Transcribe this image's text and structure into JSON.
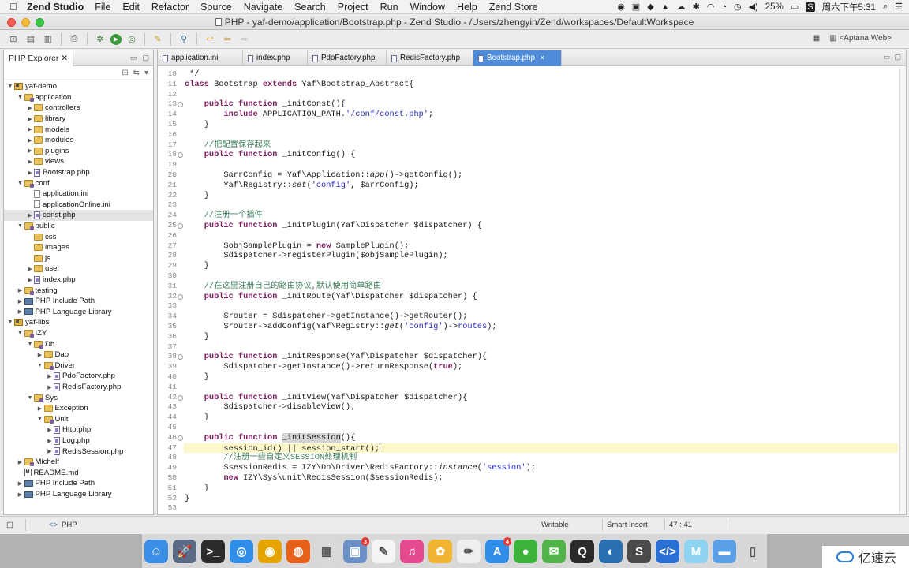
{
  "menubar": {
    "app_name": "Zend Studio",
    "menus": [
      "File",
      "Edit",
      "Refactor",
      "Source",
      "Navigate",
      "Search",
      "Project",
      "Run",
      "Window",
      "Help",
      "Zend Store"
    ],
    "battery": "25%",
    "clock": "周六下午5:31"
  },
  "window": {
    "title": "PHP - yaf-demo/application/Bootstrap.php - Zend Studio - /Users/zhengyin/Zend/workspaces/DefaultWorkspace",
    "perspective": "<Aptana Web>"
  },
  "explorer": {
    "title": "PHP Explorer",
    "tree": [
      {
        "label": "yaf-demo",
        "icon": "project",
        "expanded": true,
        "depth": 0
      },
      {
        "label": "application",
        "icon": "package",
        "expanded": true,
        "depth": 1
      },
      {
        "label": "controllers",
        "icon": "folder",
        "expanded": false,
        "depth": 2
      },
      {
        "label": "library",
        "icon": "folder",
        "expanded": false,
        "depth": 2
      },
      {
        "label": "models",
        "icon": "folder",
        "expanded": false,
        "depth": 2
      },
      {
        "label": "modules",
        "icon": "folder",
        "expanded": false,
        "depth": 2
      },
      {
        "label": "plugins",
        "icon": "folder",
        "expanded": false,
        "depth": 2
      },
      {
        "label": "views",
        "icon": "folder",
        "expanded": false,
        "depth": 2
      },
      {
        "label": "Bootstrap.php",
        "icon": "php",
        "expanded": false,
        "depth": 2
      },
      {
        "label": "conf",
        "icon": "package",
        "expanded": true,
        "depth": 1
      },
      {
        "label": "application.ini",
        "icon": "file",
        "depth": 2
      },
      {
        "label": "applicationOnline.ini",
        "icon": "file",
        "depth": 2
      },
      {
        "label": "const.php",
        "icon": "php",
        "expanded": false,
        "depth": 2,
        "selected": true
      },
      {
        "label": "public",
        "icon": "package",
        "expanded": true,
        "depth": 1
      },
      {
        "label": "css",
        "icon": "folder",
        "depth": 2
      },
      {
        "label": "images",
        "icon": "folder",
        "depth": 2
      },
      {
        "label": "js",
        "icon": "folder",
        "depth": 2
      },
      {
        "label": "user",
        "icon": "folder",
        "expanded": false,
        "depth": 2
      },
      {
        "label": "index.php",
        "icon": "php",
        "expanded": false,
        "depth": 2
      },
      {
        "label": "testing",
        "icon": "package",
        "expanded": false,
        "depth": 1
      },
      {
        "label": "PHP Include Path",
        "icon": "library",
        "expanded": false,
        "depth": 1
      },
      {
        "label": "PHP Language Library",
        "icon": "library",
        "expanded": false,
        "depth": 1
      },
      {
        "label": "yaf-libs",
        "icon": "project",
        "expanded": true,
        "depth": 0
      },
      {
        "label": "IZY",
        "icon": "package",
        "expanded": true,
        "depth": 1
      },
      {
        "label": "Db",
        "icon": "package",
        "expanded": true,
        "depth": 2
      },
      {
        "label": "Dao",
        "icon": "folder",
        "expanded": false,
        "depth": 3
      },
      {
        "label": "Driver",
        "icon": "package",
        "expanded": true,
        "depth": 3
      },
      {
        "label": "PdoFactory.php",
        "icon": "php",
        "expanded": false,
        "depth": 4
      },
      {
        "label": "RedisFactory.php",
        "icon": "php",
        "expanded": false,
        "depth": 4
      },
      {
        "label": "Sys",
        "icon": "package",
        "expanded": true,
        "depth": 2
      },
      {
        "label": "Exception",
        "icon": "folder",
        "expanded": false,
        "depth": 3
      },
      {
        "label": "Unit",
        "icon": "package",
        "expanded": true,
        "depth": 3
      },
      {
        "label": "Http.php",
        "icon": "php",
        "expanded": false,
        "depth": 4
      },
      {
        "label": "Log.php",
        "icon": "php",
        "expanded": false,
        "depth": 4
      },
      {
        "label": "RedisSession.php",
        "icon": "php",
        "expanded": false,
        "depth": 4
      },
      {
        "label": "Michelf",
        "icon": "package",
        "expanded": false,
        "depth": 1
      },
      {
        "label": "README.md",
        "icon": "markdown",
        "depth": 1
      },
      {
        "label": "PHP Include Path",
        "icon": "library",
        "expanded": false,
        "depth": 1
      },
      {
        "label": "PHP Language Library",
        "icon": "library",
        "expanded": false,
        "depth": 1
      }
    ]
  },
  "editor": {
    "tabs": [
      {
        "label": "application.ini",
        "active": false
      },
      {
        "label": "index.php",
        "active": false
      },
      {
        "label": "PdoFactory.php",
        "active": false
      },
      {
        "label": "RedisFactory.php",
        "active": false
      },
      {
        "label": "Bootstrap.php",
        "active": true
      }
    ],
    "current_line": 47,
    "lines": [
      {
        "n": 10,
        "parts": [
          [
            "",
            " */"
          ]
        ]
      },
      {
        "n": 11,
        "parts": [
          [
            "kw",
            "class"
          ],
          [
            "",
            " Bootstrap "
          ],
          [
            "kw",
            "extends"
          ],
          [
            "",
            " Yaf\\Bootstrap_Abstract{"
          ]
        ]
      },
      {
        "n": 12,
        "parts": []
      },
      {
        "n": 13,
        "parts": [
          [
            "",
            "    "
          ],
          [
            "kw",
            "public function"
          ],
          [
            "",
            " _initConst(){"
          ]
        ]
      },
      {
        "n": 14,
        "parts": [
          [
            "",
            "        "
          ],
          [
            "kw",
            "include"
          ],
          [
            "",
            " APPLICATION_PATH."
          ],
          [
            "str",
            "'/conf/const.php'"
          ],
          [
            "",
            ";"
          ]
        ]
      },
      {
        "n": 15,
        "parts": [
          [
            "",
            "    }"
          ]
        ]
      },
      {
        "n": 16,
        "parts": []
      },
      {
        "n": 17,
        "parts": [
          [
            "",
            "    "
          ],
          [
            "cm",
            "//把配置保存起来"
          ]
        ]
      },
      {
        "n": 18,
        "parts": [
          [
            "",
            "    "
          ],
          [
            "kw",
            "public function"
          ],
          [
            "",
            " _initConfig() {"
          ]
        ]
      },
      {
        "n": 19,
        "parts": []
      },
      {
        "n": 20,
        "parts": [
          [
            "",
            "        $arrConfig = Yaf\\Application::"
          ],
          [
            "fn",
            "app"
          ],
          [
            "",
            "()->getConfig();"
          ]
        ]
      },
      {
        "n": 21,
        "parts": [
          [
            "",
            "        Yaf\\Registry::"
          ],
          [
            "fn",
            "set"
          ],
          [
            "",
            "("
          ],
          [
            "str",
            "'config'"
          ],
          [
            "",
            ", $arrConfig);"
          ]
        ]
      },
      {
        "n": 22,
        "parts": [
          [
            "",
            "    }"
          ]
        ]
      },
      {
        "n": 23,
        "parts": []
      },
      {
        "n": 24,
        "parts": [
          [
            "",
            "    "
          ],
          [
            "cm",
            "//注册一个插件"
          ]
        ]
      },
      {
        "n": 25,
        "parts": [
          [
            "",
            "    "
          ],
          [
            "kw",
            "public function"
          ],
          [
            "",
            " _initPlugin(Yaf\\Dispatcher $dispatcher) {"
          ]
        ]
      },
      {
        "n": 26,
        "parts": []
      },
      {
        "n": 27,
        "parts": [
          [
            "",
            "        $objSamplePlugin = "
          ],
          [
            "kw",
            "new"
          ],
          [
            "",
            " SamplePlugin();"
          ]
        ]
      },
      {
        "n": 28,
        "parts": [
          [
            "",
            "        $dispatcher->registerPlugin($objSamplePlugin);"
          ]
        ]
      },
      {
        "n": 29,
        "parts": [
          [
            "",
            "    }"
          ]
        ]
      },
      {
        "n": 30,
        "parts": []
      },
      {
        "n": 31,
        "parts": [
          [
            "",
            "    "
          ],
          [
            "cm",
            "//在这里注册自己的路由协议,默认使用简单路由"
          ]
        ]
      },
      {
        "n": 32,
        "parts": [
          [
            "",
            "    "
          ],
          [
            "kw",
            "public function"
          ],
          [
            "",
            " _initRoute(Yaf\\Dispatcher $dispatcher) {"
          ]
        ]
      },
      {
        "n": 33,
        "parts": []
      },
      {
        "n": 34,
        "parts": [
          [
            "",
            "        $router = $dispatcher->getInstance()->getRouter();"
          ]
        ]
      },
      {
        "n": 35,
        "parts": [
          [
            "",
            "        $router->addConfig(Yaf\\Registry::"
          ],
          [
            "fn",
            "get"
          ],
          [
            "",
            "("
          ],
          [
            "str",
            "'config'"
          ],
          [
            "",
            ")->"
          ],
          [
            "str",
            "routes"
          ],
          [
            "",
            ");"
          ]
        ]
      },
      {
        "n": 36,
        "parts": [
          [
            "",
            "    }"
          ]
        ]
      },
      {
        "n": 37,
        "parts": []
      },
      {
        "n": 38,
        "parts": [
          [
            "",
            "    "
          ],
          [
            "kw",
            "public function"
          ],
          [
            "",
            " _initResponse(Yaf\\Dispatcher $dispatcher){"
          ]
        ]
      },
      {
        "n": 39,
        "parts": [
          [
            "",
            "        $dispatcher->getInstance()->returnResponse("
          ],
          [
            "kw",
            "true"
          ],
          [
            "",
            ");"
          ]
        ]
      },
      {
        "n": 40,
        "parts": [
          [
            "",
            "    }"
          ]
        ]
      },
      {
        "n": 41,
        "parts": []
      },
      {
        "n": 42,
        "parts": [
          [
            "",
            "    "
          ],
          [
            "kw",
            "public function"
          ],
          [
            "",
            " _initView(Yaf\\Dispatcher $dispatcher){"
          ]
        ]
      },
      {
        "n": 43,
        "parts": [
          [
            "",
            "        $dispatcher->disableView();"
          ]
        ]
      },
      {
        "n": 44,
        "parts": [
          [
            "",
            "    }"
          ]
        ]
      },
      {
        "n": 45,
        "parts": []
      },
      {
        "n": 46,
        "parts": [
          [
            "",
            "    "
          ],
          [
            "kw",
            "public function"
          ],
          [
            "",
            " "
          ],
          [
            "hl",
            "_initSession"
          ],
          [
            "",
            "(){"
          ]
        ]
      },
      {
        "n": 47,
        "parts": [
          [
            "",
            "        session_id() || session_start();"
          ]
        ]
      },
      {
        "n": 48,
        "parts": [
          [
            "",
            "        "
          ],
          [
            "cm",
            "//注册一些自定义SESSION处理机制"
          ]
        ]
      },
      {
        "n": 49,
        "parts": [
          [
            "",
            "        $sessionRedis = IZY\\Db\\Driver\\RedisFactory::"
          ],
          [
            "fn",
            "instance"
          ],
          [
            "",
            "("
          ],
          [
            "str",
            "'session'"
          ],
          [
            "",
            ");"
          ]
        ]
      },
      {
        "n": 50,
        "parts": [
          [
            "",
            "        "
          ],
          [
            "kw",
            "new"
          ],
          [
            "",
            " IZY\\Sys\\unit\\RedisSession($sessionRedis);"
          ]
        ]
      },
      {
        "n": 51,
        "parts": [
          [
            "",
            "    }"
          ]
        ]
      },
      {
        "n": 52,
        "parts": [
          [
            "",
            "}"
          ]
        ]
      },
      {
        "n": 53,
        "parts": []
      }
    ],
    "fold_lines": [
      13,
      18,
      25,
      32,
      38,
      42,
      46
    ]
  },
  "statusbar": {
    "lang": "PHP",
    "mode": "Writable",
    "insert": "Smart Insert",
    "position": "47 : 41"
  },
  "dock": {
    "apps": [
      {
        "name": "finder",
        "color": "#3a8ee6",
        "glyph": "☺"
      },
      {
        "name": "launchpad",
        "color": "#5b6b86",
        "glyph": "🚀"
      },
      {
        "name": "terminal",
        "color": "#2b2b2b",
        "glyph": ">_"
      },
      {
        "name": "safari",
        "color": "#2f8fe8",
        "glyph": "◎"
      },
      {
        "name": "chrome",
        "color": "#e6a400",
        "glyph": "◉"
      },
      {
        "name": "firefox",
        "color": "#e8611a",
        "glyph": "◍"
      },
      {
        "name": "apps-grid",
        "color": "#d9d9d9",
        "glyph": "▦"
      },
      {
        "name": "preview",
        "color": "#6c90c5",
        "glyph": "▣",
        "badge": "3"
      },
      {
        "name": "textedit",
        "color": "#f4f4f4",
        "glyph": "✎"
      },
      {
        "name": "itunes",
        "color": "#e64a8e",
        "glyph": "♫"
      },
      {
        "name": "photos",
        "color": "#f1b430",
        "glyph": "✿"
      },
      {
        "name": "notes",
        "color": "#efefef",
        "glyph": "✏"
      },
      {
        "name": "app-store",
        "color": "#2f8fe8",
        "glyph": "A",
        "badge": "4"
      },
      {
        "name": "evernote",
        "color": "#3cb43c",
        "glyph": "●"
      },
      {
        "name": "wechat",
        "color": "#52b34a",
        "glyph": "✉"
      },
      {
        "name": "qq",
        "color": "#2a2a2a",
        "glyph": "Q"
      },
      {
        "name": "navicat",
        "color": "#2a6fb0",
        "glyph": "◐"
      },
      {
        "name": "sublime",
        "color": "#4a4a4a",
        "glyph": "S"
      },
      {
        "name": "zend-studio",
        "color": "#2a6fd4",
        "glyph": "</>"
      },
      {
        "name": "mou",
        "color": "#8ed3f0",
        "glyph": "M"
      },
      {
        "name": "folder",
        "color": "#5aa0e8",
        "glyph": "▬"
      },
      {
        "name": "trash",
        "color": "#d8d8d8",
        "glyph": "▯"
      }
    ]
  },
  "watermark": {
    "text": "亿速云"
  },
  "colors": {
    "active_tab": "#4f8bd8",
    "keyword": "#7a1b5e",
    "string": "#2a2ac8",
    "comment": "#3d7d5b",
    "current_line": "#fbf7c8"
  }
}
